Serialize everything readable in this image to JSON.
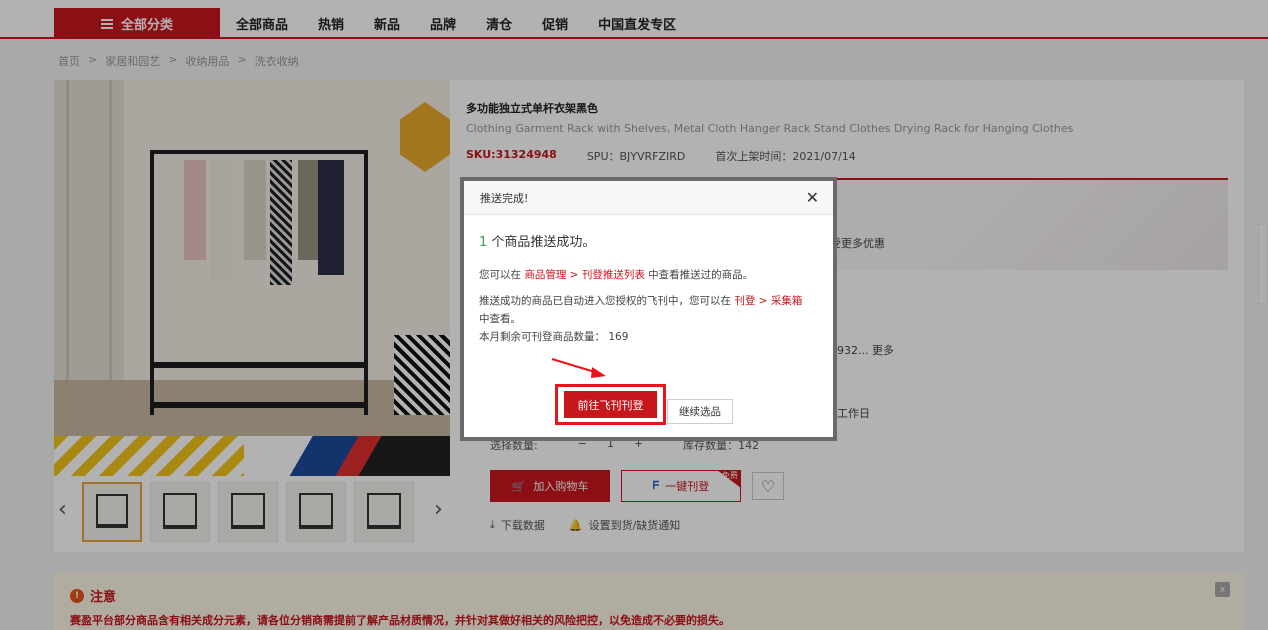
{
  "nav": {
    "category_label": "全部分类",
    "links": [
      "全部商品",
      "热销",
      "新品",
      "品牌",
      "清仓",
      "促销",
      "中国直发专区"
    ]
  },
  "breadcrumb": [
    "首页",
    "家居和园艺",
    "收纳用品",
    "洗衣收纳"
  ],
  "breadcrumb_sep": ">",
  "product": {
    "title": "多功能独立式单杆衣架黑色",
    "subtitle": "Clothing Garment Rack with Shelves, Metal Cloth Hanger Rack Stand Clothes Drying Rack for Hanging Clothes",
    "sku": "SKU:31324948",
    "spu": "SPU：BJYVRFZIRD",
    "listed": "首次上架时间：2021/07/14",
    "partial_promo": "受更多优惠",
    "partial_spec": "3932...  更多",
    "partial_delivery": "7工作日",
    "qty_label": "选择数量:",
    "qty_value": "1",
    "qty_minus": "−",
    "qty_plus": "+",
    "stock": "库存数量：142",
    "add_cart": "加入购物车",
    "one_click": "一键刊登",
    "free_badge": "免费",
    "download": "下载数据",
    "notify": "设置到货/缺货通知"
  },
  "notice": {
    "title": "注意",
    "text": "赛盈平台部分商品含有相关成分元素，请各位分销商需提前了解产品材质情况，并针对其做好相关的风险把控，以免造成不必要的损失。",
    "close": "x"
  },
  "modal": {
    "title": "推送完成!",
    "close": "✕",
    "count": "1",
    "success_text": " 个商品推送成功。",
    "line2_prefix": "您可以在 ",
    "line2_link": "商品管理 > 刊登推送列表",
    "line2_suffix": " 中查看推送过的商品。",
    "line3_prefix": "推送成功的商品已自动进入您授权的飞刊中，您可以在 ",
    "line3_link": "刊登 > 采集箱",
    "line3_suffix": "中查看。",
    "line4": "本月剩余可刊登商品数量： 169",
    "btn_primary": "前往飞刊刊登",
    "btn_secondary": "继续选品"
  },
  "colors": {
    "brand_red": "#c8161d",
    "success_green": "#2fa34a",
    "highlight_red": "#e8131b"
  }
}
